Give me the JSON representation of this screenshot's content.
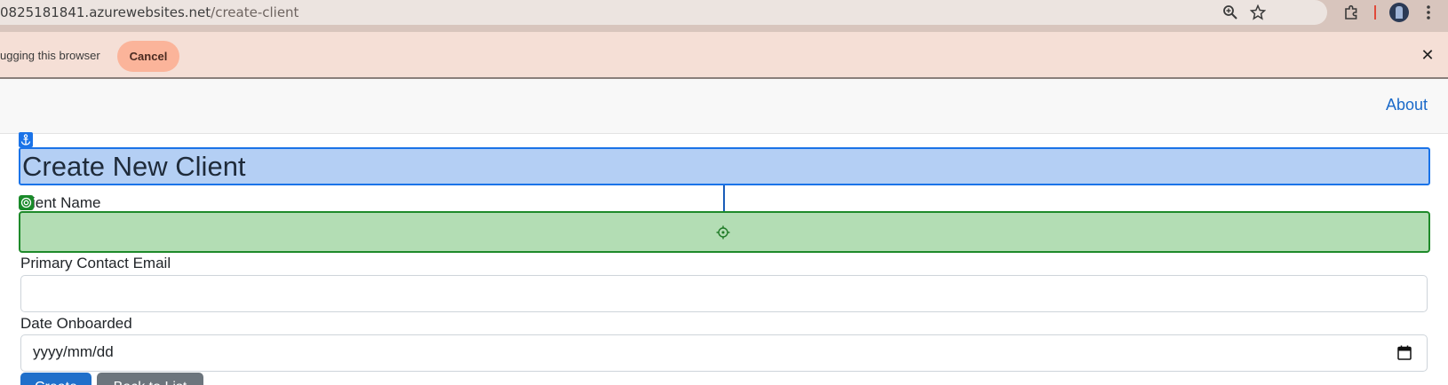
{
  "browser": {
    "url_host": "0825181841.azurewebsites.net",
    "url_path": "/create-client",
    "icons": [
      "zoom-icon",
      "star-icon",
      "extensions-icon",
      "profile-avatar",
      "menu-dots-icon"
    ]
  },
  "infobar": {
    "message": "ugging this browser",
    "cancel_label": "Cancel",
    "close_glyph": "✕"
  },
  "navbar": {
    "about_label": "About"
  },
  "form": {
    "title": "Create New Client",
    "client_name_label": "ient Name",
    "client_name_value": "",
    "email_label": "Primary Contact Email",
    "email_value": "",
    "date_label": "Date Onboarded",
    "date_placeholder": "yyyy/mm/dd",
    "submit_label": "Create",
    "back_label": "Back to List"
  },
  "colors": {
    "accent": "#1a73e8",
    "highlight_blue": "#b4cff4",
    "highlight_green": "#b3ddb4",
    "green_border": "#1e8a2a",
    "primary_button": "#1f6fca",
    "secondary_button": "#6c757d",
    "infobar_bg": "#f5dfd6",
    "cancel_bg": "#fbb49a"
  }
}
